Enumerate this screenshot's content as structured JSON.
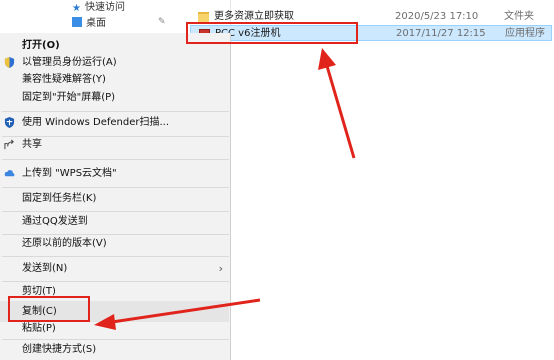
{
  "nav": {
    "quick_access": "快速访问",
    "desktop": "桌面"
  },
  "files": [
    {
      "name": "更多资源立即获取",
      "date": "2020/5/23 17:10",
      "type": "文件夹",
      "icon": "folder-icon"
    },
    {
      "name": "PCC v6注册机",
      "date": "2017/11/27 12:15",
      "type": "应用程序",
      "icon": "exe-icon"
    }
  ],
  "menu": {
    "items": [
      {
        "label": "打开(O)",
        "bold": true
      },
      {
        "label": "以管理员身份运行(A)",
        "icon": "shield-icon"
      },
      {
        "label": "兼容性疑难解答(Y)"
      },
      {
        "label": "固定到\"开始\"屏幕(P)"
      },
      {
        "label": "使用 Windows Defender扫描...",
        "icon": "defender-icon"
      },
      {
        "label": "共享",
        "icon": "share-icon"
      },
      {
        "label": "上传到 \"WPS云文档\"",
        "icon": "cloud-icon"
      },
      {
        "label": "固定到任务栏(K)"
      },
      {
        "label": "通过QQ发送到"
      },
      {
        "label": "还原以前的版本(V)"
      },
      {
        "label": "发送到(N)",
        "submenu": true
      },
      {
        "label": "剪切(T)"
      },
      {
        "label": "复制(C)"
      },
      {
        "label": "粘贴(P)"
      },
      {
        "label": "创建快捷方式(S)"
      }
    ],
    "arrow": "›"
  },
  "colors": {
    "annotation": "#e0241b",
    "selection": "#cce8ff"
  }
}
